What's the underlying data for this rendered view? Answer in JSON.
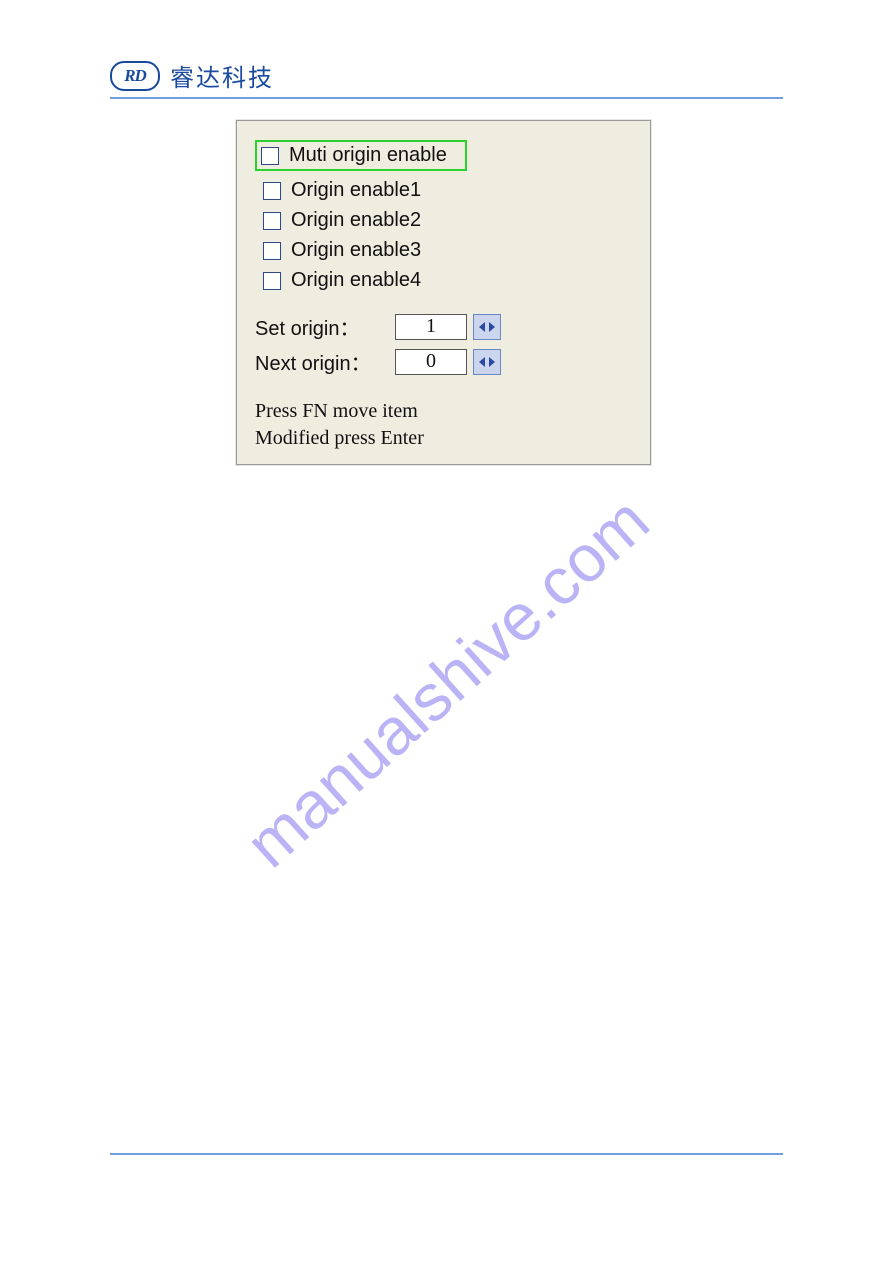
{
  "header": {
    "logo_text": "RD",
    "brand": "睿达科技"
  },
  "dialog": {
    "checkboxes": [
      {
        "label": "Muti origin enable",
        "selected": true
      },
      {
        "label": "Origin enable1",
        "selected": false
      },
      {
        "label": "Origin enable2",
        "selected": false
      },
      {
        "label": "Origin enable3",
        "selected": false
      },
      {
        "label": "Origin enable4",
        "selected": false
      }
    ],
    "set_origin_label": "Set origin：",
    "set_origin_value": "1",
    "next_origin_label": "Next origin：",
    "next_origin_value": "0",
    "help_line1": "Press FN move item",
    "help_line2": "Modified press Enter"
  },
  "watermark": "manualshive.com"
}
